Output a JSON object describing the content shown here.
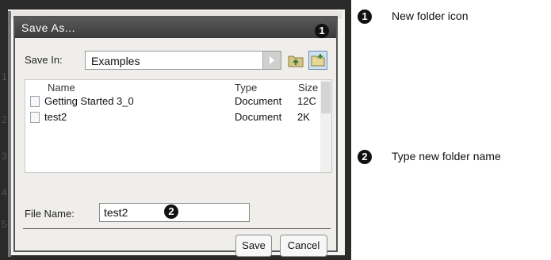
{
  "dialog": {
    "title": "Save As...",
    "save_in_label": "Save In:",
    "save_in_value": "Examples",
    "columns": [
      "Name",
      "Type",
      "Size"
    ],
    "files": [
      {
        "name": "Getting Started 3_0",
        "type": "Document",
        "size": "12C"
      },
      {
        "name": "test2",
        "type": "Document",
        "size": "2K"
      }
    ],
    "file_name_label": "File Name:",
    "file_name_value": "test2",
    "save_label": "Save",
    "cancel_label": "Cancel"
  },
  "callouts": [
    {
      "number": "1",
      "text": "New folder icon"
    },
    {
      "number": "2",
      "text": "Type new folder name"
    }
  ],
  "icons": {
    "up_folder": "folder-up-icon",
    "new_folder": "new-folder-icon",
    "document": "document-icon"
  },
  "background_labels": [
    "1",
    "2",
    "3",
    "4",
    "5"
  ]
}
